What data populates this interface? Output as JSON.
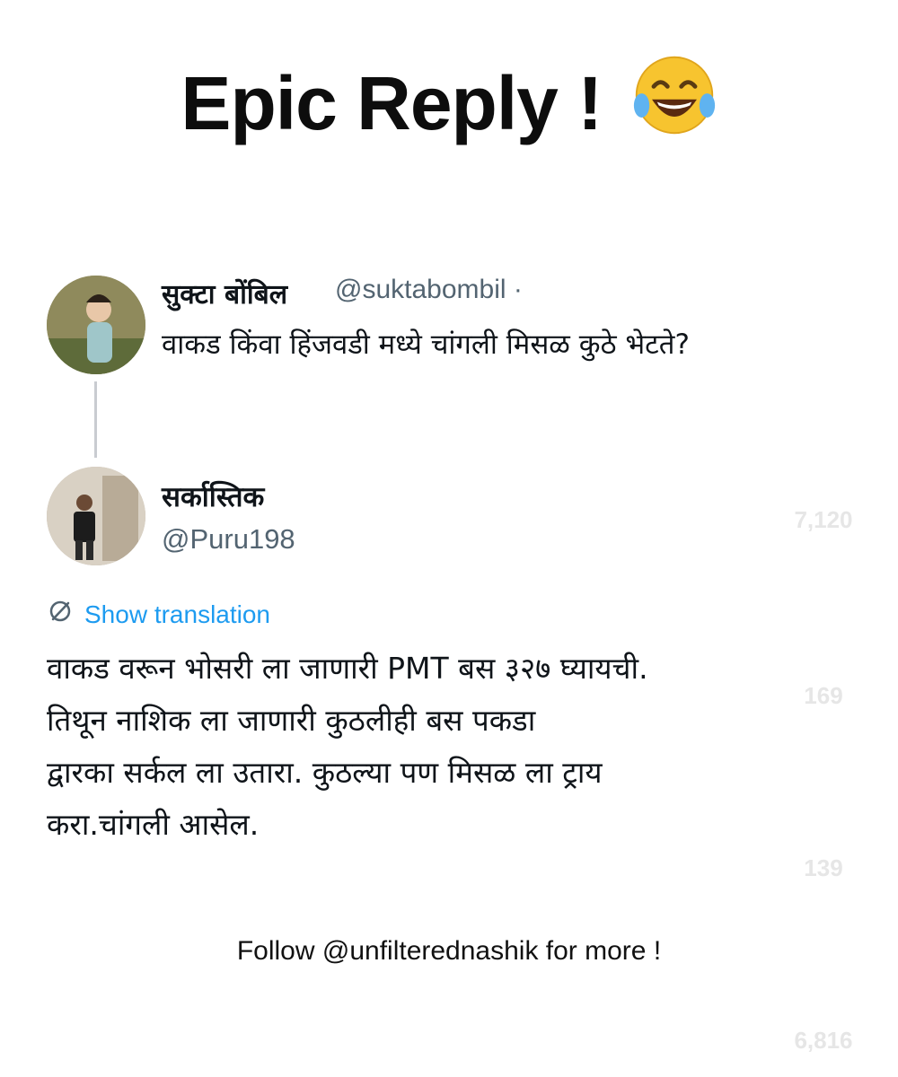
{
  "header": {
    "title": "Epic Reply !",
    "emoji_icon": "face-with-tears-of-joy-icon"
  },
  "tweet": {
    "author_name": "सुक्टा बोंबिल",
    "author_handle": "@suktabombil ·",
    "text": "वाकड किंवा हिंजवडी मध्ये चांगली मिसळ कुठे भेटते?"
  },
  "reply": {
    "author_name": "सर्कास्तिक",
    "author_handle": "@Puru198",
    "translate_label": "Show translation",
    "lines": [
      "वाकड वरून भोसरी ला जाणारी PMT बस ३२७ घ्यायची.",
      "तिथून नाशिक ला जाणारी कुठलीही बस पकडा",
      "द्वारका सर्कल ला उतारा. कुठल्या पण मिसळ ला ट्राय",
      "करा.चांगली आसेल."
    ]
  },
  "footer": {
    "follow_text": "Follow @unfilterednashik for more !"
  },
  "sidebar_actions": {
    "likes": "7,120",
    "comments": "169",
    "reposts": "139",
    "shares": "6,816"
  },
  "colors": {
    "link": "#1d9bf0",
    "muted": "#536471",
    "overlay_icon": "#ffffff"
  }
}
